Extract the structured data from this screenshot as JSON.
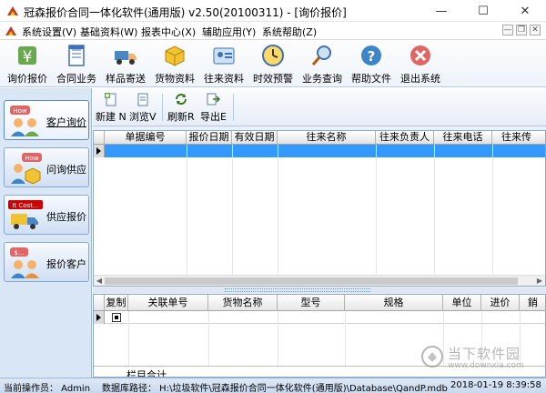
{
  "window": {
    "title": "冠森报价合同一体化软件(通用版) v2.50(20100311) - [询价报价]",
    "minimize": "—",
    "maximize": "☐",
    "close": "✕"
  },
  "menu": {
    "items": [
      "系统设置(V)",
      "基础资料(W)",
      "报表中心(X)",
      "辅助应用(Y)",
      "系统帮助(Z)"
    ],
    "mdi_controls": [
      "—",
      "❐",
      "✕"
    ]
  },
  "toolbar": {
    "buttons": [
      {
        "label": "询价报价",
        "icon": "price-tag-icon"
      },
      {
        "label": "合同业务",
        "icon": "contract-icon"
      },
      {
        "label": "样品寄送",
        "icon": "truck-icon"
      },
      {
        "label": "货物资料",
        "icon": "box-icon"
      },
      {
        "label": "往来资料",
        "icon": "address-card-icon"
      },
      {
        "label": "时效预警",
        "icon": "clock-icon"
      },
      {
        "label": "业务查询",
        "icon": "magnifier-icon"
      },
      {
        "label": "帮助文件",
        "icon": "help-icon"
      },
      {
        "label": "退出系统",
        "icon": "exit-icon"
      }
    ]
  },
  "nav": {
    "items": [
      {
        "label": "客户询价",
        "badge": "How",
        "active": true
      },
      {
        "label": "问询供应",
        "badge": "How",
        "active": false
      },
      {
        "label": "供应报价",
        "badge": "It Cost...",
        "active": false
      },
      {
        "label": "报价客户",
        "badge": "$...",
        "active": false
      }
    ]
  },
  "subtoolbar": {
    "new": "新建 N",
    "browse": "浏览V",
    "refresh": "刷新R",
    "export": "导出E"
  },
  "grid1": {
    "columns": [
      "单据编号",
      "报价日期",
      "有效日期",
      "往来名称",
      "往来负责人",
      "往来电话",
      "往来传"
    ]
  },
  "grid2": {
    "columns": [
      "复制",
      "关联单号",
      "货物名称",
      "型号",
      "规格",
      "单位",
      "进价",
      "銷"
    ],
    "total_label": "栏目合计"
  },
  "status": {
    "operator": "当前操作员：  Admin",
    "db_path": "数据库路径：  H:\\垃圾软件\\冠森报价合同一体化软件(通用版)\\Database\\QandP.mdb",
    "datetime": "2018-01-19 8:39:58"
  },
  "watermark": {
    "text": "当下软件园",
    "sub": "www.downxia.com"
  },
  "colors": {
    "selection": "#3399ff",
    "panel": "#d9e6f6"
  }
}
